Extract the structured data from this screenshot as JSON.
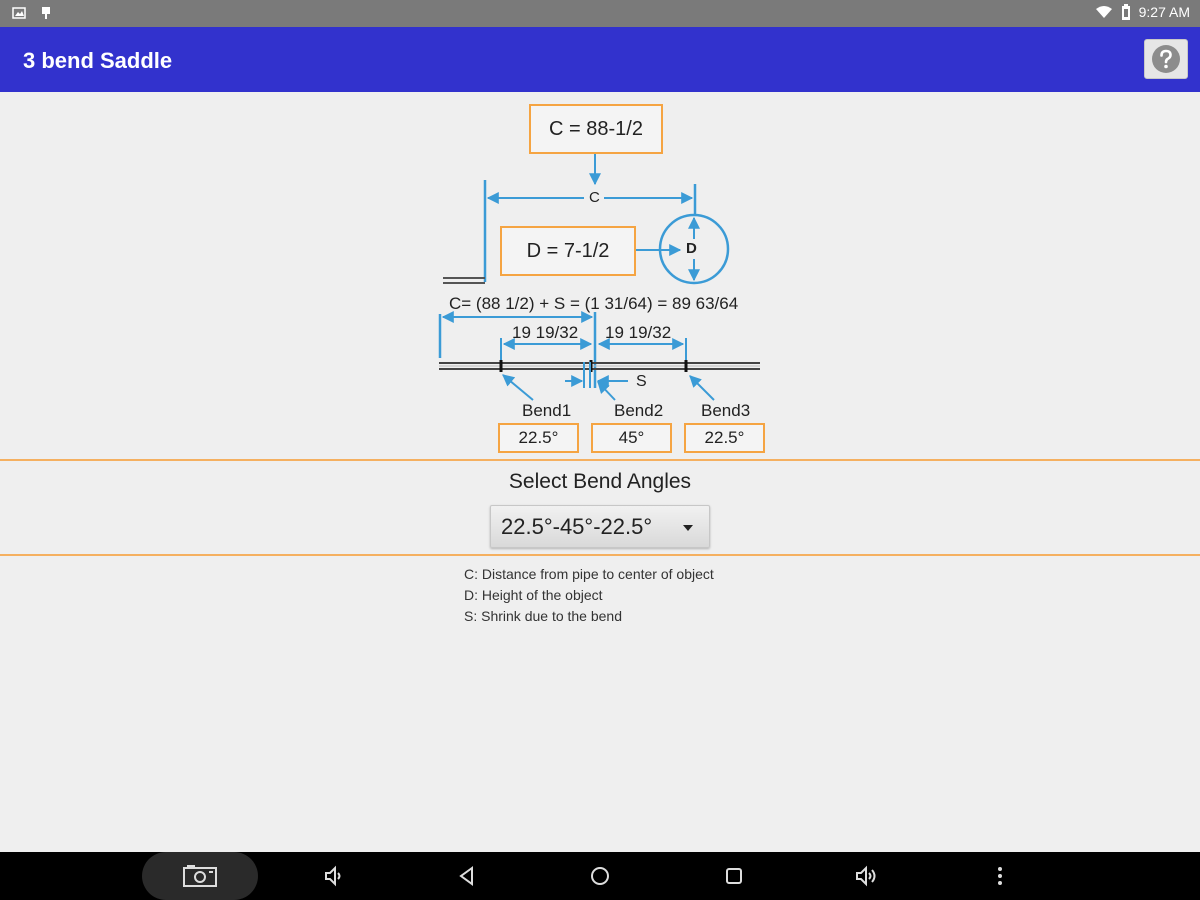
{
  "status_bar": {
    "time": "9:27 AM"
  },
  "app_bar": {
    "title": "3 bend Saddle",
    "help_icon": "question-mark-icon"
  },
  "diagram": {
    "c_box": "C = 88-1/2",
    "c_label": "C",
    "d_box": "D = 7-1/2",
    "d_label": "D",
    "formula": "C= (88 1/2) + S = (1 31/64) = 89 63/64",
    "dim_left": "19 19/32",
    "dim_right": "19 19/32",
    "s_label": "S",
    "bend1_label": "Bend1",
    "bend2_label": "Bend2",
    "bend3_label": "Bend3",
    "bend1_value": "22.5°",
    "bend2_value": "45°",
    "bend3_value": "22.5°"
  },
  "selector": {
    "label": "Select Bend Angles",
    "value": "22.5°-45°-22.5°"
  },
  "legend": [
    "C: Distance from pipe to center of object",
    "D: Height of the object",
    "S: Shrink due to the bend"
  ],
  "colors": {
    "app_bar": "#3232cd",
    "accent_orange": "#f5a442",
    "diagram_blue": "#3b9bd6"
  }
}
